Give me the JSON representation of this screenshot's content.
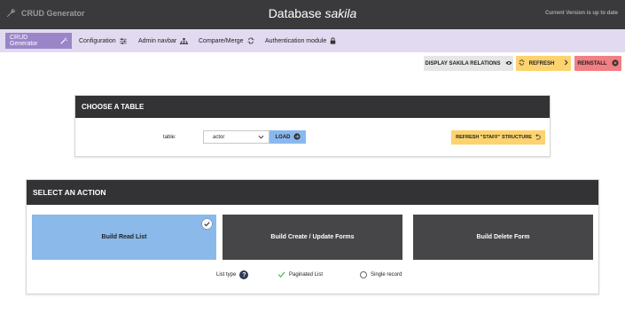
{
  "header": {
    "app_name": "CRUD Generator",
    "title_prefix": "Database ",
    "db_name": "sakila",
    "version_status": "Current Version is up to date"
  },
  "nav": {
    "items": [
      {
        "label": "CRUD Generator",
        "icon": "magic-wand-icon",
        "active": true
      },
      {
        "label": "Configuration",
        "icon": "sliders-icon",
        "active": false
      },
      {
        "label": "Admin navbar",
        "icon": "sitemap-icon",
        "active": false
      },
      {
        "label": "Compare/Merge",
        "icon": "sync-icon",
        "active": false
      },
      {
        "label": "Authentication module",
        "icon": "lock-icon",
        "active": false
      }
    ]
  },
  "actions": {
    "display_relations": "DISPLAY SAKILA RELATIONS",
    "refresh": "REFRESH",
    "reinstall": "REINSTALL"
  },
  "choose_table": {
    "heading": "CHOOSE A TABLE",
    "table_label": "table:",
    "selected_table": "actor",
    "load_label": "LOAD",
    "refresh_structure_label": "REFRESH \"STAFF\" STRUCTURE"
  },
  "select_action": {
    "heading": "SELECT AN ACTION",
    "tiles": [
      {
        "label": "Build Read List",
        "selected": true
      },
      {
        "label": "Build Create / Update Forms",
        "selected": false
      },
      {
        "label": "Build Delete Form",
        "selected": false
      }
    ],
    "list_type_label": "List type",
    "options": [
      {
        "label": "Paginated List",
        "checked": true
      },
      {
        "label": "Single record",
        "checked": false
      }
    ]
  },
  "colors": {
    "header_bg": "#3a3a3c",
    "nav_bg": "#e2daf0",
    "nav_active": "#9a85c9",
    "info_blue": "#8ab8ee",
    "warning_yellow": "#fcd36e",
    "danger_red": "#f27f84"
  }
}
